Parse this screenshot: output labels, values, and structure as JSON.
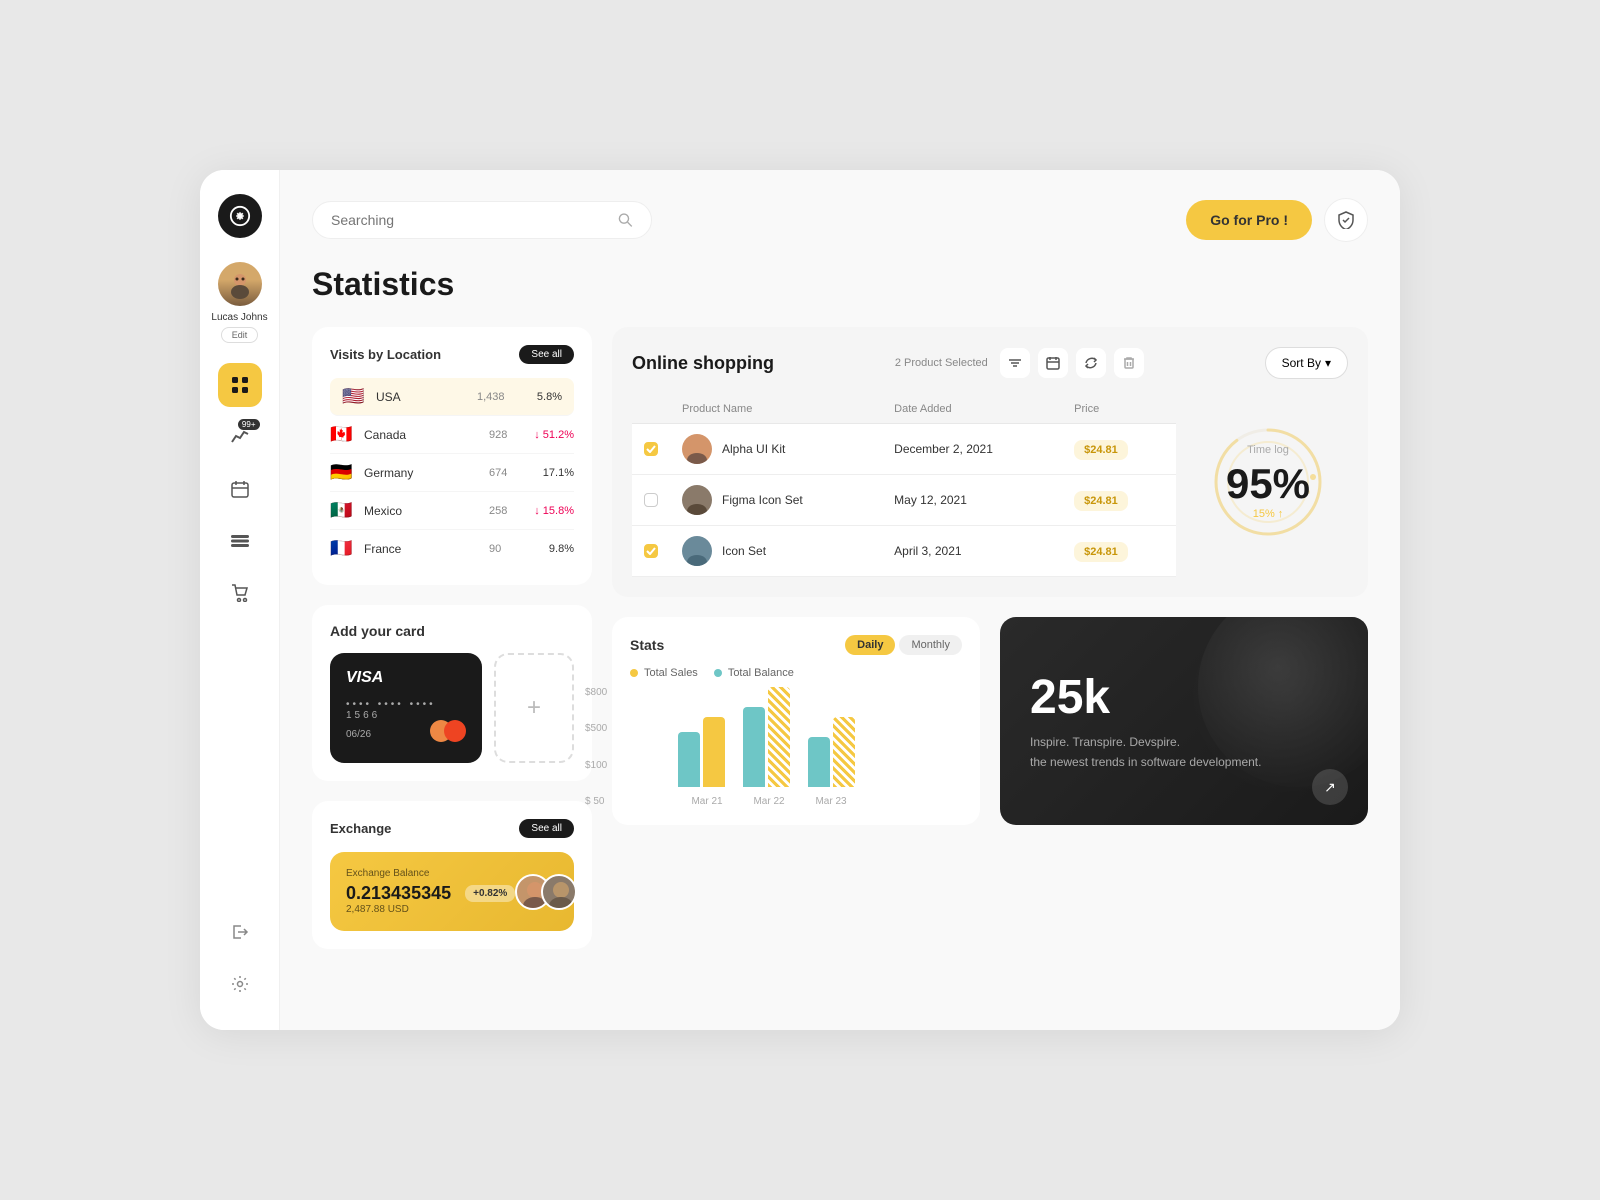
{
  "app": {
    "title": "Statistics"
  },
  "sidebar": {
    "logo_symbol": "✳",
    "user": {
      "name": "Lucas Johns",
      "edit_label": "Edit"
    },
    "items": [
      {
        "id": "grid",
        "icon": "⊞",
        "active": true
      },
      {
        "id": "chart",
        "icon": "📈",
        "badge": "99+"
      },
      {
        "id": "calendar",
        "icon": "📅"
      },
      {
        "id": "minus",
        "icon": "▬"
      },
      {
        "id": "cart",
        "icon": "🛒"
      }
    ],
    "bottom": [
      {
        "id": "logout",
        "icon": "→"
      },
      {
        "id": "settings",
        "icon": "⚙"
      }
    ]
  },
  "header": {
    "search": {
      "placeholder": "Searching",
      "value": "Searching"
    },
    "go_pro_label": "Go for Pro !",
    "security_icon": "shield"
  },
  "visits": {
    "title": "Visits by Location",
    "see_all": "See all",
    "items": [
      {
        "flag": "🇺🇸",
        "country": "USA",
        "count": "1,438",
        "pct": "5.8%",
        "direction": "up",
        "highlight": true
      },
      {
        "flag": "🇨🇦",
        "country": "Canada",
        "count": "928",
        "pct": "↓ 51.2%",
        "direction": "down"
      },
      {
        "flag": "🇩🇪",
        "country": "Germany",
        "count": "674",
        "pct": "17.1%",
        "direction": "up"
      },
      {
        "flag": "🇲🇽",
        "country": "Mexico",
        "count": "258",
        "pct": "↓ 15.8%",
        "direction": "down"
      },
      {
        "flag": "🇫🇷",
        "country": "France",
        "count": "90",
        "pct": "9.8%",
        "direction": "up"
      }
    ]
  },
  "card_section": {
    "title": "Add your card",
    "visa": {
      "logo": "VISA",
      "dots": "•••• •••• •••• 1566",
      "expiry": "06/26"
    },
    "add_label": "+"
  },
  "exchange": {
    "title": "Exchange",
    "see_all": "See all",
    "card": {
      "label": "Exchange Balance",
      "amount": "0.213435345",
      "usd": "2,487.88 USD",
      "pct": "+0.82%"
    }
  },
  "shopping": {
    "title": "Online shopping",
    "products_selected": "2 Product Selected",
    "sort_label": "Sort By",
    "columns": [
      "Product Name",
      "Date Added",
      "Price"
    ],
    "rows": [
      {
        "checked": true,
        "name": "Alpha UI Kit",
        "date": "December 2, 2021",
        "price": "$24.81"
      },
      {
        "checked": false,
        "name": "Figma Icon Set",
        "date": "May 12, 2021",
        "price": "$24.81"
      },
      {
        "checked": true,
        "name": "Icon Set",
        "date": "April 3, 2021",
        "price": "$24.81"
      }
    ]
  },
  "timelog": {
    "label": "Time log",
    "percentage": "95%",
    "sub_pct": "15%",
    "up_arrow": "↑"
  },
  "stats": {
    "title": "Stats",
    "tabs": [
      "Daily",
      "Monthly"
    ],
    "active_tab": "Daily",
    "legend": [
      "Total Sales",
      "Total Balance"
    ],
    "y_labels": [
      "$800",
      "$500",
      "$100",
      "$ 50"
    ],
    "x_labels": [
      "Mar 21",
      "Mar 22",
      "Mar 23"
    ],
    "bars": [
      [
        60,
        80,
        40
      ],
      [
        90,
        110,
        65
      ]
    ]
  },
  "promo": {
    "number": "25k",
    "line1": "Inspire. Transpire. Devspire.",
    "line2": "the newest trends in software development.",
    "arrow": "↗"
  }
}
